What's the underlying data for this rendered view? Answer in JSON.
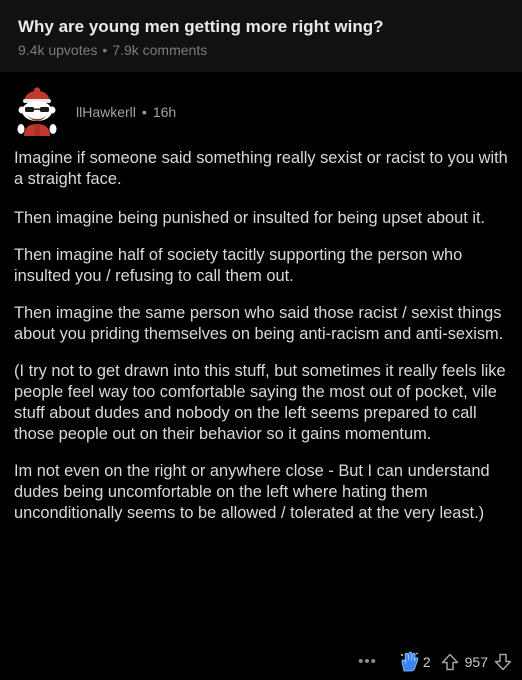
{
  "post": {
    "title": "Why are young men getting more right wing?",
    "upvotes": "9.4k upvotes",
    "separator": "•",
    "comments": "7.9k comments"
  },
  "comment": {
    "author": "llHawkerll",
    "separator": "•",
    "age": "16h",
    "avatar_icon": "snoo-avatar-icon",
    "paragraphs": [
      "Imagine if someone said something really sexist or racist to you with a straight face.",
      "Then imagine being punished or insulted for being upset about it.",
      "Then imagine half of society tacitly supporting the person who insulted you / refusing to call them out.",
      "Then imagine the same person who said those racist / sexist things about you priding themselves on being anti-racism and anti-sexism.",
      "(I try not to get drawn into this stuff, but sometimes it really feels like people feel way too comfortable saying the most out of pocket, vile stuff about dudes and nobody on the left seems prepared to call those people out on their behavior so it gains momentum.",
      "Im not even on the right or anywhere close - But I can understand dudes being uncomfortable on the left where hating them unconditionally seems to be allowed / tolerated at the very least.)"
    ],
    "actions": {
      "more_label": "•••",
      "award_icon": "award-hand-icon",
      "award_count": "2",
      "upvote_icon": "upvote-arrow-icon",
      "score": "957",
      "downvote_icon": "downvote-arrow-icon"
    }
  },
  "colors": {
    "background": "#000000",
    "header_background": "#111111",
    "text": "#d7dadc",
    "muted": "#7c7c7c",
    "award_blue": "#3b82f6"
  }
}
